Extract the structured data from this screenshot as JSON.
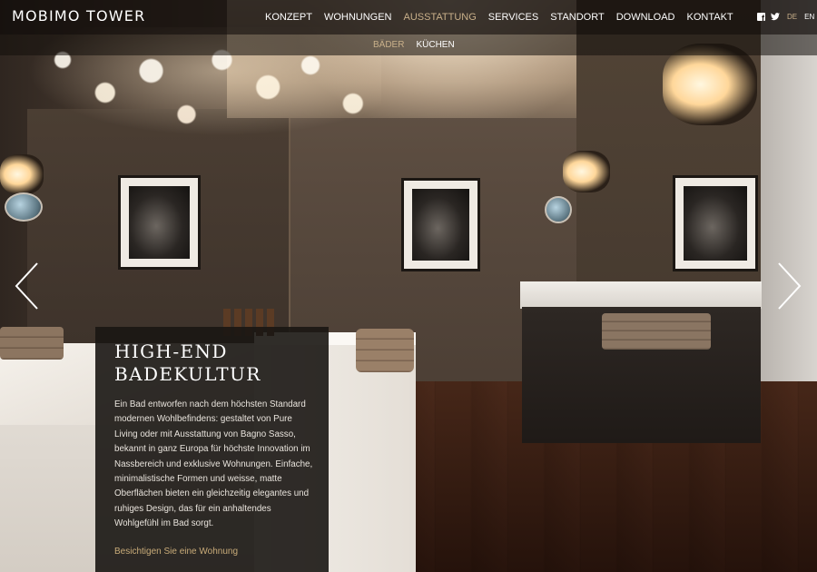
{
  "site": {
    "logo": "MOBIMO TOWER"
  },
  "main_nav": {
    "items": [
      {
        "label": "KONZEPT",
        "active": false
      },
      {
        "label": "WOHNUNGEN",
        "active": false
      },
      {
        "label": "AUSSTATTUNG",
        "active": true
      },
      {
        "label": "SERVICES",
        "active": false
      },
      {
        "label": "STANDORT",
        "active": false
      },
      {
        "label": "DOWNLOAD",
        "active": false
      },
      {
        "label": "KONTAKT",
        "active": false
      }
    ]
  },
  "sub_nav": {
    "items": [
      {
        "label": "BÄDER",
        "active": true
      },
      {
        "label": "KÜCHEN",
        "active": false
      }
    ]
  },
  "social": {
    "icons": [
      "facebook-icon",
      "twitter-icon"
    ],
    "languages": [
      {
        "label": "DE",
        "active": true
      },
      {
        "label": "EN",
        "active": false
      }
    ]
  },
  "slider": {
    "prev_icon": "chevron-left-icon",
    "next_icon": "chevron-right-icon"
  },
  "panel": {
    "title_line1": "HIGH-END",
    "title_line2": "BADEKULTUR",
    "text": "Ein Bad entworfen nach dem höchsten Standard modernen Wohlbefindens: gestaltet von Pure Living oder mit Ausstattung von Bagno Sasso, bekannt in ganz Europa für höchste Innovation im Nassbereich und exklusive Wohnungen. Einfache, minimalistische Formen und weisse, matte Oberflächen bieten ein gleichzeitig elegantes und ruhiges Design, das für ein anhaltendes Wohlgefühl im Bad sorgt.",
    "link": "Besichtigen Sie eine Wohnung"
  },
  "colors": {
    "accent": "#c9b08a",
    "link": "#c9ab79",
    "header_bg": "#120e0b",
    "panel_bg": "#1a1613"
  }
}
